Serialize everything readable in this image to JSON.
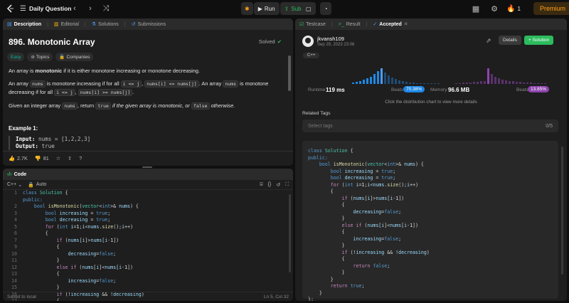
{
  "topbar": {
    "problem_list_label": "Daily Question",
    "run_label": "Run",
    "submit_label": "Submit",
    "streak": "1",
    "premium_label": "Premium"
  },
  "left_tabs": [
    {
      "label": "Description"
    },
    {
      "label": "Editorial"
    },
    {
      "label": "Solutions"
    },
    {
      "label": "Submissions"
    }
  ],
  "problem": {
    "title": "896. Monotonic Array",
    "status": "Solved",
    "difficulty": "Easy",
    "topics_label": "Topics",
    "companies_label": "Companies",
    "p1_pre": "An array is ",
    "p1_bold": "monotonic",
    "p1_post": " if it is either monotone increasing or monotone decreasing.",
    "p2_a": "An array ",
    "p2_nums1": "nums",
    "p2_b": " is monotone increasing if for all ",
    "p2_cond1": "i <= j",
    "p2_c": ", ",
    "p2_cond2": "nums[i] <= nums[j]",
    "p2_d": ". An array ",
    "p2_nums2": "nums",
    "p2_e": " is monotone decreasing if for all ",
    "p2_cond3": "i <= j",
    "p2_f": ", ",
    "p2_cond4": "nums[i] >= nums[j]",
    "p2_g": ".",
    "p3_a": "Given an integer array ",
    "p3_nums": "nums",
    "p3_b": ", return ",
    "p3_true": "true",
    "p3_c": " if the given array is monotonic, or ",
    "p3_false": "false",
    "p3_d": " otherwise.",
    "example_title": "Example 1:",
    "input_label": "Input:",
    "input_value": "nums = [1,2,2,3]",
    "output_label": "Output:",
    "output_value": "true",
    "likes": "2.7K",
    "dislikes": "81"
  },
  "code_panel": {
    "title": "Code",
    "language": "C++",
    "mode": "Auto",
    "saved_status": "Saved to local",
    "cursor": "Ln 5, Col 32"
  },
  "right_tabs": [
    {
      "label": "Testcase"
    },
    {
      "label": "Result"
    },
    {
      "label": "Accepted"
    }
  ],
  "submission": {
    "username": "jkvansh109",
    "date": "Sep 29, 2023 23:06",
    "details_label": "Details",
    "solution_label": "+ Solution",
    "language_badge": "C++",
    "runtime_label": "Runtime",
    "runtime_value": "119 ms",
    "beats_label_1": "Beats",
    "beats_runtime": "70.38%",
    "memory_label": "Memory",
    "memory_value": "96.6 MB",
    "beats_label_2": "Beats",
    "beats_memory": "13.85%",
    "chart_hint": "Click the distribution chart to view more details",
    "related_tags_label": "Related Tags",
    "select_tags_placeholder": "Select tags",
    "tags_count": "0/5",
    "colors": {
      "runtime": "#1e88e5",
      "memory": "#8e44ad",
      "accent": "#ffa116",
      "green": "#2cbb5d"
    }
  }
}
